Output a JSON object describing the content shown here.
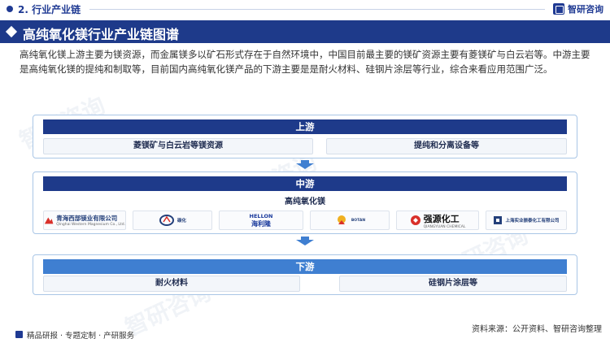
{
  "header": {
    "section_label": "2. 行业产业链",
    "brand_name": "智研咨询"
  },
  "title": "高纯氧化镁行业产业链图谱",
  "intro": "高纯氧化镁上游主要为镁资源，而金属镁多以矿石形式存在于自然环境中，中国目前最主要的镁矿资源主要有菱镁矿与白云岩等。中游主要是高纯氧化镁的提纯和制取等，目前国内高纯氧化镁产品的下游主要是是耐火材料、硅钢片涂层等行业，综合来看应用范围广泛。",
  "upstream": {
    "label": "上游",
    "items": [
      "菱镁矿与白云岩等镁资源",
      "提纯和分离设备等"
    ]
  },
  "midstream": {
    "label": "中游",
    "product": "高纯氧化镁",
    "companies": [
      {
        "name": "青海西部镁业有限公司",
        "sub": "Qinghai Western Magnesium Co., Ltd."
      },
      {
        "name": "碳化"
      },
      {
        "name": "HELLON",
        "sub": "海利隆"
      },
      {
        "name": "BOTAN"
      },
      {
        "name": "强源化工",
        "sub": "QIANGYUAN CHEMICAL"
      },
      {
        "name": "上海实业振泰化工有限公司"
      }
    ]
  },
  "downstream": {
    "label": "下游",
    "items": [
      "耐火材料",
      "硅钢片涂层等"
    ]
  },
  "source": "资料来源：公开资料、智研咨询整理",
  "footer": {
    "left": "精品研报 · 专题定制 · 产研服务"
  },
  "colors": {
    "primary": "#1e3a8a",
    "accent": "#3f7fd1",
    "panel_border": "#a9c6e6"
  }
}
